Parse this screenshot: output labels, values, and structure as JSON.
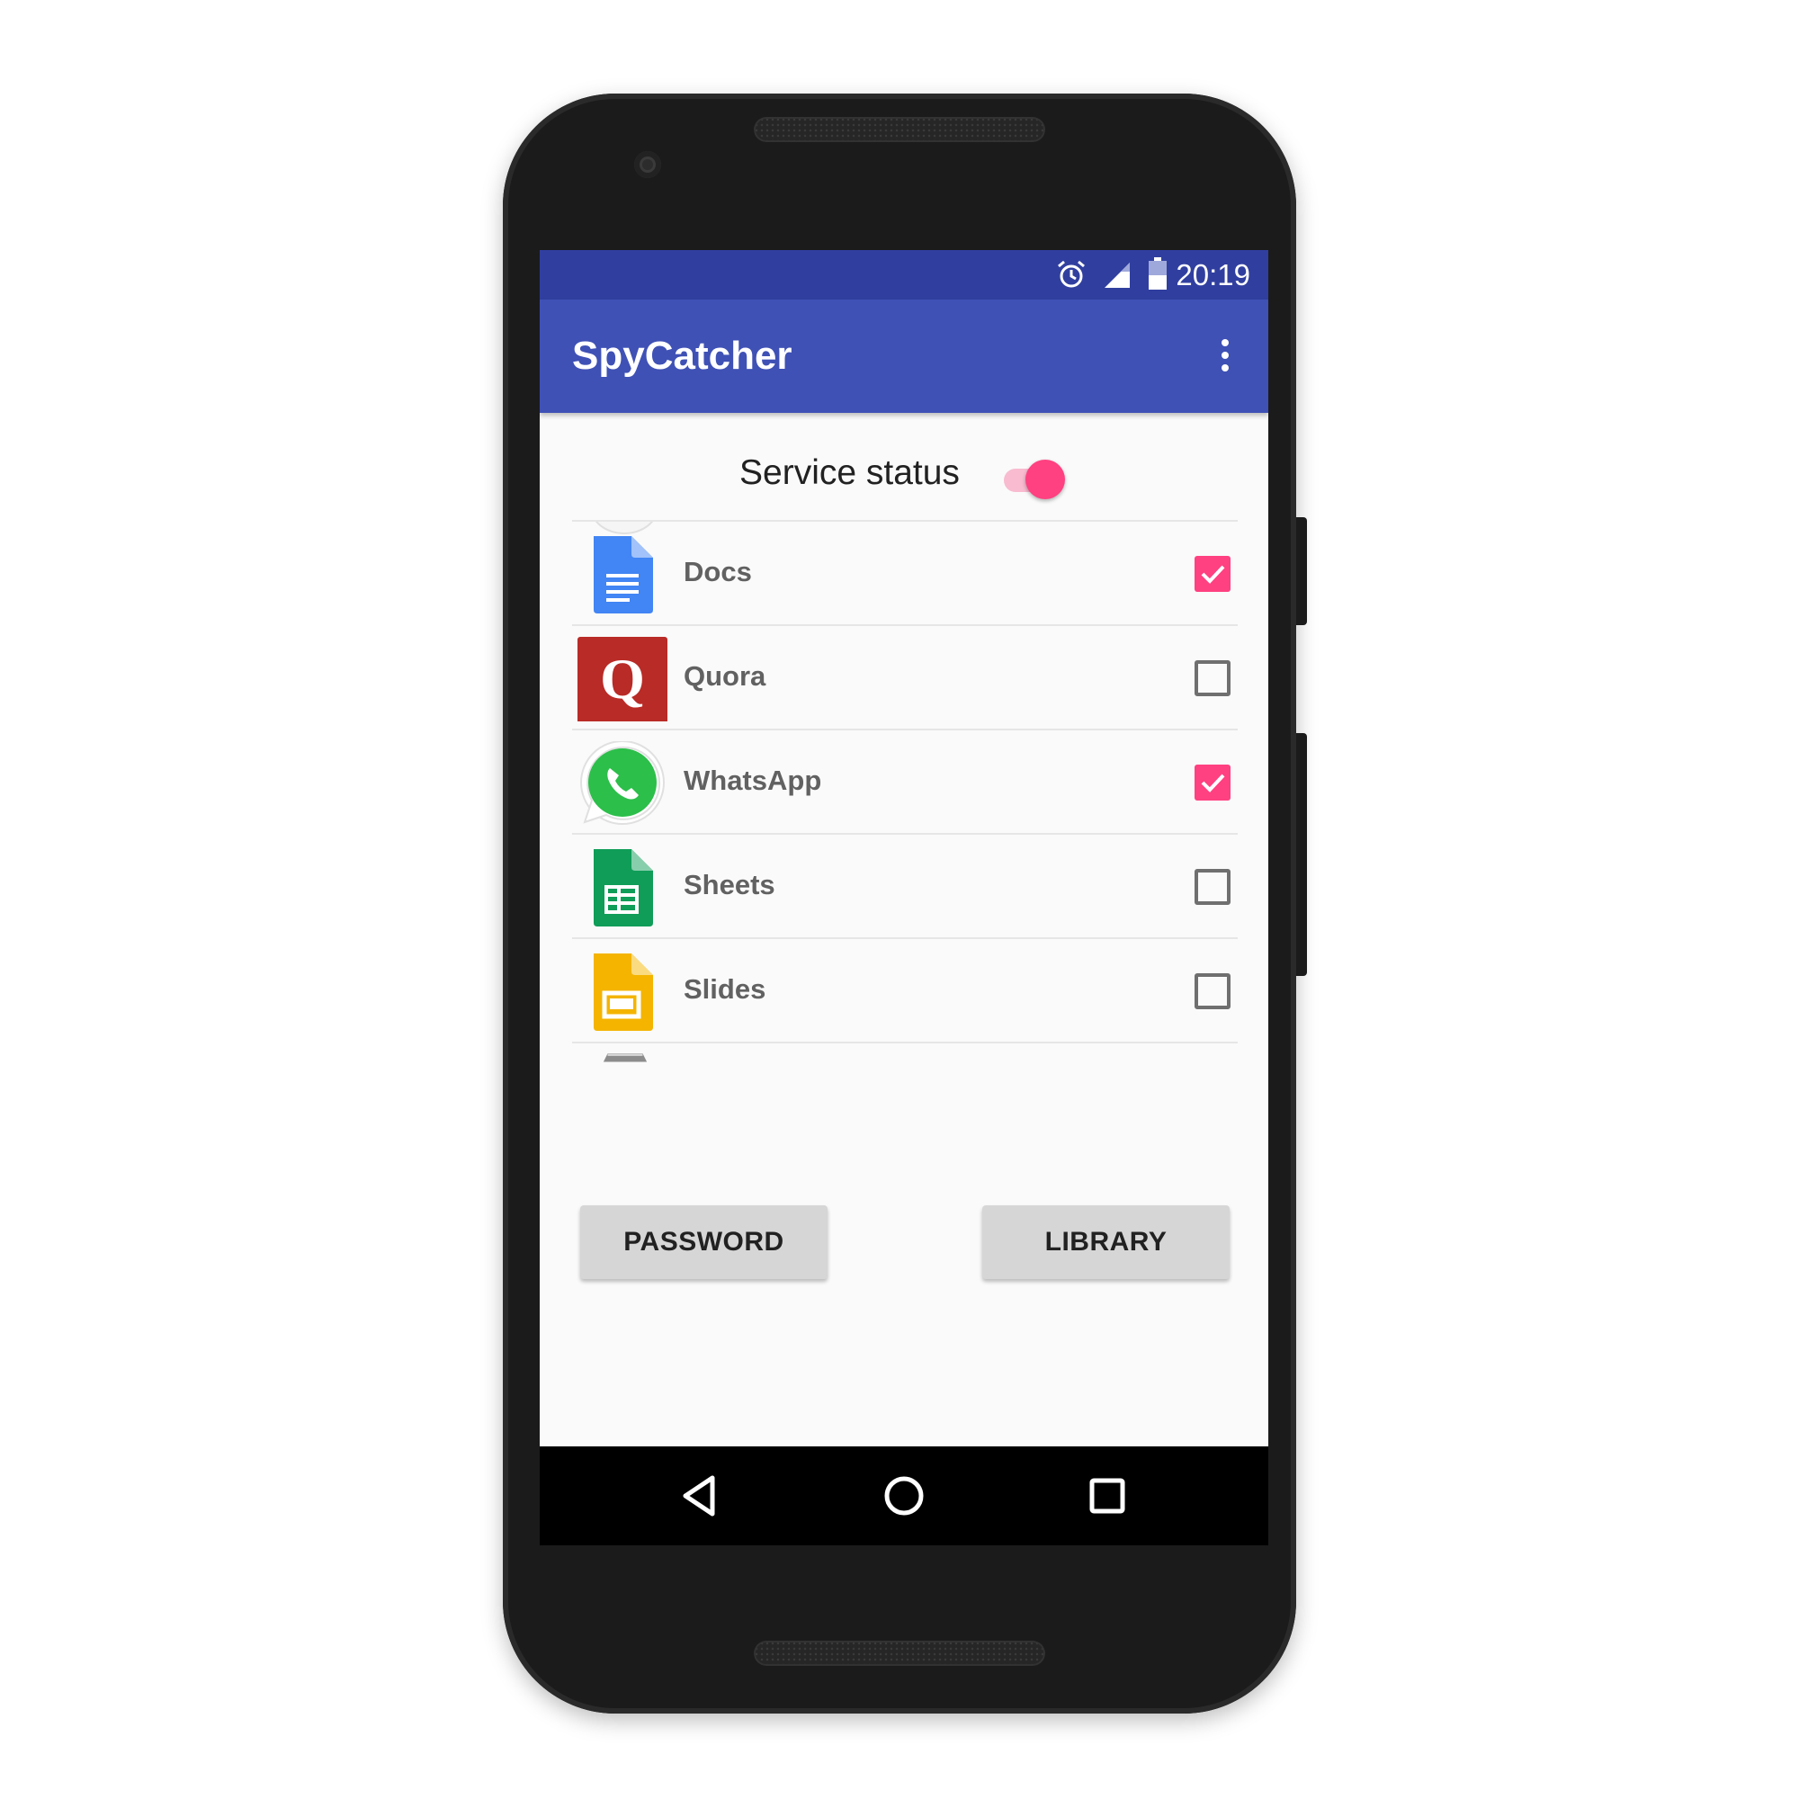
{
  "status_bar": {
    "time": "20:19",
    "icons": [
      "alarm-icon",
      "signal-icon",
      "battery-icon"
    ]
  },
  "app_bar": {
    "title": "SpyCatcher",
    "menu_icon": "overflow-menu-icon"
  },
  "service": {
    "label": "Service status",
    "enabled": true
  },
  "apps": [
    {
      "name": "Docs",
      "icon": "docs-icon",
      "checked": true
    },
    {
      "name": "Quora",
      "icon": "quora-icon",
      "checked": false
    },
    {
      "name": "WhatsApp",
      "icon": "whatsapp-icon",
      "checked": true
    },
    {
      "name": "Sheets",
      "icon": "sheets-icon",
      "checked": false
    },
    {
      "name": "Slides",
      "icon": "slides-icon",
      "checked": false
    }
  ],
  "buttons": {
    "password": "PASSWORD",
    "library": "LIBRARY"
  },
  "nav": [
    "back-icon",
    "home-icon",
    "recents-icon"
  ],
  "colors": {
    "primary": "#3f51b5",
    "primary_dark": "#303f9f",
    "accent": "#ff4081"
  }
}
